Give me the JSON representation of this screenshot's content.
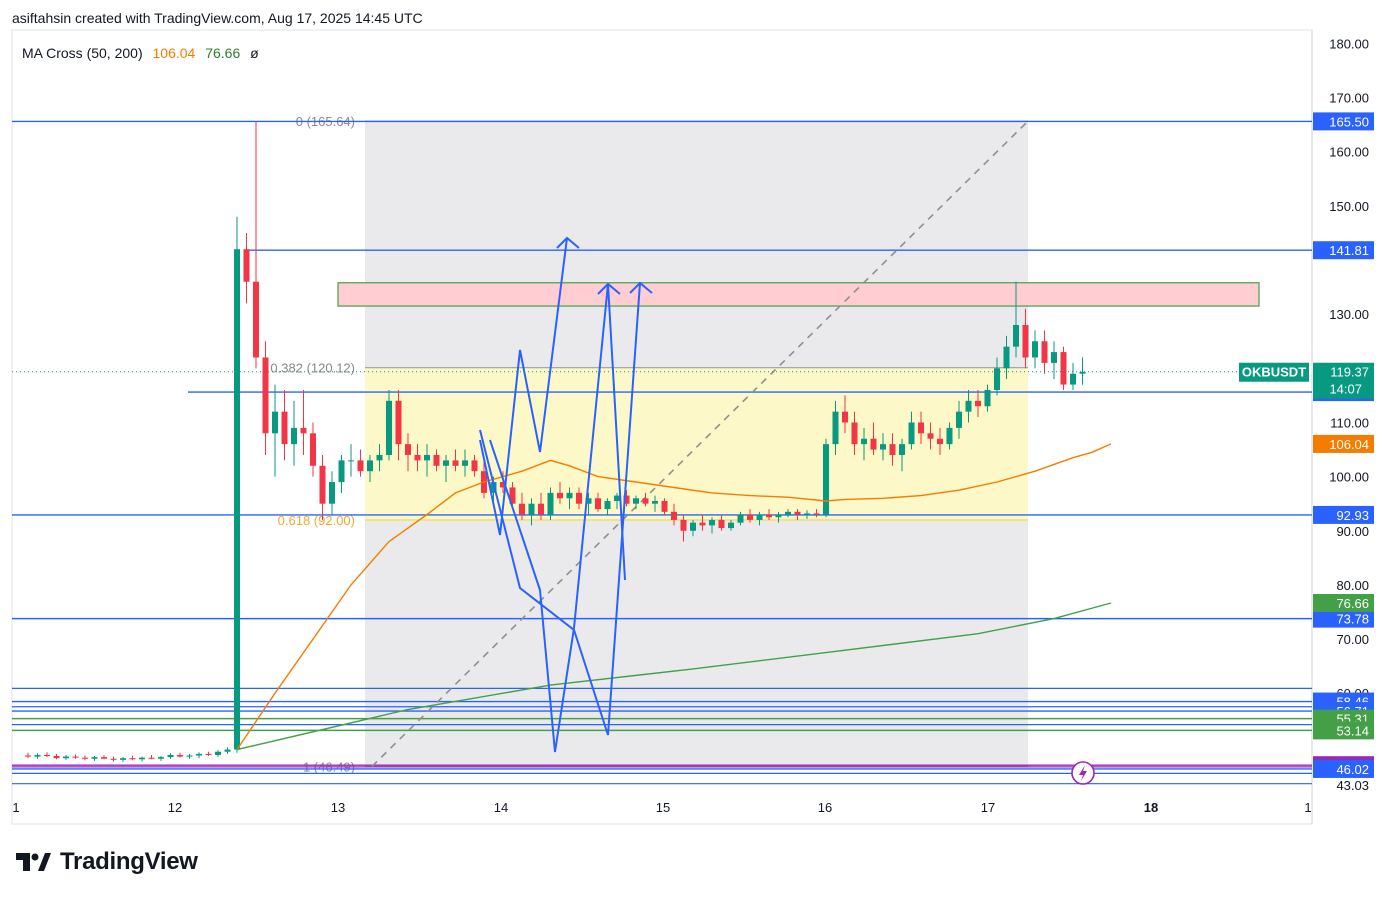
{
  "header": {
    "caption": "asiftahsin created with TradingView.com, Aug 17, 2025 14:45 UTC"
  },
  "indicator": {
    "name": "MA Cross (50, 200)",
    "ma_fast_value": "106.04",
    "ma_slow_value": "76.66",
    "extra_symbol": "ø"
  },
  "branding": {
    "logo_text": "TradingView"
  },
  "colors": {
    "up": "#089981",
    "down": "#f23645",
    "hline": "#2962ff",
    "zigzag": "#2962ff",
    "ma_fast": "#f57c00",
    "ma_slow": "#43a047",
    "fib_zone": "#fff9c4",
    "supply_zone": "#ffcdd2",
    "purple_line": "#9c27b0",
    "symbol_tag": "#089981"
  },
  "chart_data": {
    "type": "candlestick",
    "symbol": "OKBUSDT",
    "last_price": 119.37,
    "last_price_label": "119.37",
    "countdown_label": "14:07",
    "ylim": [
      42.5,
      181
    ],
    "x_axis_ticks": [
      "1",
      "12",
      "13",
      "14",
      "15",
      "16",
      "17",
      "18",
      "1"
    ],
    "x_axis_bold_tick": "18",
    "y_axis_ticks": [
      "180.00",
      "170.00",
      "160.00",
      "150.00",
      "130.00",
      "110.00",
      "100.00",
      "90.00",
      "80.00",
      "70.00",
      "60.00",
      "43.03"
    ],
    "price_level_lines": [
      {
        "label": "165.50",
        "value": 165.6,
        "color": "#2962ff"
      },
      {
        "label": "141.81",
        "value": 141.81,
        "color": "#2962ff"
      },
      {
        "label": "115.61",
        "value": 115.61,
        "color": "#2962ff"
      },
      {
        "label": "92.93",
        "value": 92.93,
        "color": "#2962ff"
      },
      {
        "label": "73.78",
        "value": 73.78,
        "color": "#2962ff"
      },
      {
        "label": "58.46",
        "value": 58.46,
        "color": "#2962ff"
      },
      {
        "label": "56.71",
        "value": 56.71,
        "color": "#2962ff"
      },
      {
        "label": "55.31",
        "value": 55.31,
        "color": "#43a047"
      },
      {
        "label": "53.14",
        "value": 53.14,
        "color": "#43a047"
      },
      {
        "label": "46.71",
        "value": 46.71,
        "color": "#9c27b0"
      },
      {
        "label": "46.02",
        "value": 46.02,
        "color": "#2962ff"
      }
    ],
    "extra_hlines": [
      60.9,
      57.5,
      54.2,
      46.4,
      45.2,
      43.3
    ],
    "ma_fast": {
      "label": "106.04",
      "value": 106.04
    },
    "ma_slow": {
      "label": "76.66",
      "value": 76.66
    },
    "fib_levels": [
      {
        "label": "0 (165.64)",
        "value": 165.64
      },
      {
        "label": "0.382 (120.12)",
        "value": 120.12
      },
      {
        "label": "0.618 (92.00)",
        "value": 92.0
      },
      {
        "label": "1 (46.49)",
        "value": 46.49
      }
    ],
    "supply_zone": [
      131.5,
      135.8
    ],
    "candles": [
      [
        48.5,
        49.0,
        48.0,
        48.3
      ],
      [
        48.3,
        48.9,
        47.9,
        48.6
      ],
      [
        48.6,
        49.1,
        48.2,
        48.4
      ],
      [
        48.4,
        48.8,
        47.8,
        48.0
      ],
      [
        48.0,
        48.6,
        47.7,
        48.3
      ],
      [
        48.3,
        48.7,
        47.9,
        48.1
      ],
      [
        48.1,
        48.5,
        47.6,
        47.9
      ],
      [
        47.9,
        48.4,
        47.5,
        48.2
      ],
      [
        48.2,
        48.6,
        47.8,
        47.9
      ],
      [
        47.9,
        48.3,
        47.4,
        47.7
      ],
      [
        47.7,
        48.2,
        47.3,
        48.0
      ],
      [
        48.0,
        48.5,
        47.6,
        47.8
      ],
      [
        47.8,
        48.3,
        47.4,
        48.1
      ],
      [
        48.1,
        48.6,
        47.8,
        47.9
      ],
      [
        47.9,
        48.4,
        47.5,
        48.2
      ],
      [
        48.2,
        48.9,
        47.9,
        48.6
      ],
      [
        48.6,
        49.0,
        48.1,
        48.3
      ],
      [
        48.3,
        48.8,
        47.9,
        48.5
      ],
      [
        48.5,
        49.1,
        48.0,
        48.8
      ],
      [
        48.8,
        49.2,
        48.4,
        48.6
      ],
      [
        48.6,
        49.5,
        48.3,
        49.2
      ],
      [
        49.2,
        50.0,
        48.8,
        49.6
      ],
      [
        49.6,
        148.0,
        49.0,
        142.0
      ],
      [
        142.0,
        145.0,
        132.0,
        136.0
      ],
      [
        136.0,
        165.64,
        120.0,
        122.0
      ],
      [
        122.0,
        125.0,
        104.0,
        108.0
      ],
      [
        108.0,
        117.0,
        100.0,
        112.0
      ],
      [
        112.0,
        116.0,
        103.0,
        106.0
      ],
      [
        106.0,
        114.0,
        102.0,
        109.0
      ],
      [
        109.0,
        116.0,
        104.0,
        108.0
      ],
      [
        108.0,
        110.0,
        100.0,
        102.0
      ],
      [
        102.0,
        104.0,
        92.0,
        95.0
      ],
      [
        95.0,
        101.0,
        93.0,
        99.0
      ],
      [
        99.0,
        104.0,
        97.0,
        103.0
      ],
      [
        103.0,
        106.0,
        100.0,
        103.0
      ],
      [
        103.0,
        105.0,
        100.0,
        101.0
      ],
      [
        101.0,
        104.0,
        99.0,
        103.0
      ],
      [
        103.0,
        106.0,
        101.0,
        104.0
      ],
      [
        104.0,
        116.0,
        103.0,
        114.0
      ],
      [
        114.0,
        116.0,
        103.0,
        106.0
      ],
      [
        106.0,
        108.0,
        101.0,
        104.0
      ],
      [
        104.0,
        106.0,
        101.0,
        103.0
      ],
      [
        103.0,
        106.0,
        100.0,
        104.0
      ],
      [
        104.0,
        105.0,
        101.0,
        102.0
      ],
      [
        102.0,
        104.0,
        99.0,
        103.0
      ],
      [
        103.0,
        105.0,
        101.0,
        102.0
      ],
      [
        102.0,
        105.0,
        100.0,
        103.0
      ],
      [
        103.0,
        104.0,
        100.0,
        101.0
      ],
      [
        101.0,
        103.0,
        96.0,
        97.0
      ],
      [
        97.0,
        100.0,
        95.0,
        99.0
      ],
      [
        99.0,
        101.0,
        97.0,
        98.0
      ],
      [
        98.0,
        99.0,
        94.0,
        95.0
      ],
      [
        95.0,
        97.0,
        92.0,
        93.0
      ],
      [
        93.0,
        96.0,
        91.0,
        95.0
      ],
      [
        95.0,
        97.0,
        92.0,
        93.0
      ],
      [
        93.0,
        98.0,
        92.0,
        97.0
      ],
      [
        97.0,
        99.0,
        95.0,
        96.0
      ],
      [
        96.0,
        98.0,
        94.0,
        97.0
      ],
      [
        97.0,
        98.0,
        94.0,
        95.0
      ],
      [
        95.0,
        97.0,
        93.0,
        96.0
      ],
      [
        96.0,
        97.0,
        93.5,
        94.0
      ],
      [
        94.0,
        96.0,
        93.0,
        95.5
      ],
      [
        95.5,
        97.0,
        94.0,
        96.5
      ],
      [
        96.5,
        97.5,
        94.5,
        95.0
      ],
      [
        95.0,
        96.5,
        94.0,
        96.0
      ],
      [
        96.0,
        97.0,
        94.5,
        95.0
      ],
      [
        95.0,
        96.5,
        93.5,
        95.5
      ],
      [
        95.5,
        96.0,
        93.0,
        93.5
      ],
      [
        93.5,
        95.0,
        91.0,
        92.0
      ],
      [
        92.0,
        93.0,
        88.0,
        90.0
      ],
      [
        90.0,
        92.0,
        89.0,
        91.5
      ],
      [
        91.5,
        93.0,
        90.0,
        91.0
      ],
      [
        91.0,
        92.5,
        89.5,
        92.0
      ],
      [
        92.0,
        93.0,
        90.0,
        90.5
      ],
      [
        90.5,
        92.0,
        90.0,
        91.5
      ],
      [
        91.5,
        93.5,
        91.0,
        93.0
      ],
      [
        93.0,
        94.0,
        91.5,
        92.0
      ],
      [
        92.0,
        93.5,
        91.0,
        93.0
      ],
      [
        93.0,
        94.0,
        92.0,
        92.5
      ],
      [
        92.5,
        93.5,
        91.5,
        93.0
      ],
      [
        93.0,
        94.0,
        92.5,
        93.5
      ],
      [
        93.5,
        94.0,
        92.0,
        93.0
      ],
      [
        93.0,
        93.8,
        92.2,
        93.2
      ],
      [
        93.2,
        94.0,
        92.5,
        93.0
      ],
      [
        93.0,
        107.0,
        92.5,
        106.0
      ],
      [
        106.0,
        114.0,
        104.0,
        112.0
      ],
      [
        112.0,
        115.0,
        108.0,
        110.0
      ],
      [
        110.0,
        112.0,
        104.0,
        106.0
      ],
      [
        106.0,
        109.0,
        103.0,
        107.0
      ],
      [
        107.0,
        110.0,
        104.0,
        105.0
      ],
      [
        105.0,
        108.0,
        103.0,
        106.0
      ],
      [
        106.0,
        108.0,
        102.0,
        104.0
      ],
      [
        104.0,
        107.0,
        101.0,
        106.0
      ],
      [
        106.0,
        112.0,
        105.0,
        110.0
      ],
      [
        110.0,
        112.0,
        106.0,
        108.0
      ],
      [
        108.0,
        110.0,
        105.0,
        107.0
      ],
      [
        107.0,
        109.0,
        104.0,
        106.0
      ],
      [
        106.0,
        110.0,
        105.0,
        109.0
      ],
      [
        109.0,
        114.0,
        107.0,
        112.0
      ],
      [
        112.0,
        116.0,
        110.0,
        114.0
      ],
      [
        114.0,
        116.0,
        111.0,
        113.0
      ],
      [
        113.0,
        117.0,
        112.0,
        116.0
      ],
      [
        116.0,
        122.0,
        115.0,
        120.0
      ],
      [
        120.0,
        126.0,
        118.0,
        124.0
      ],
      [
        124.0,
        136.0,
        122.0,
        128.0
      ],
      [
        128.0,
        131.0,
        120.0,
        122.0
      ],
      [
        122.0,
        127.0,
        120.0,
        125.0
      ],
      [
        125.0,
        127.0,
        119.0,
        121.0
      ],
      [
        121.0,
        125.0,
        118.0,
        123.0
      ],
      [
        123.0,
        124.0,
        116.0,
        117.0
      ],
      [
        117.0,
        121.0,
        116.0,
        119.0
      ],
      [
        119.0,
        122.0,
        117.0,
        119.37
      ]
    ],
    "ma_fast_series": [
      [
        22,
        49.6
      ],
      [
        26,
        60.0
      ],
      [
        30,
        70.0
      ],
      [
        34,
        80.0
      ],
      [
        38,
        88.0
      ],
      [
        42,
        93.0
      ],
      [
        45,
        97.0
      ],
      [
        48,
        99.0
      ],
      [
        52,
        101.0
      ],
      [
        55,
        103.0
      ],
      [
        57,
        102.0
      ],
      [
        60,
        100.0
      ],
      [
        64,
        99.0
      ],
      [
        68,
        98.0
      ],
      [
        72,
        97.0
      ],
      [
        76,
        96.5
      ],
      [
        80,
        96.2
      ],
      [
        84,
        95.5
      ],
      [
        86,
        95.8
      ],
      [
        90,
        96.0
      ],
      [
        94,
        96.5
      ],
      [
        98,
        97.5
      ],
      [
        102,
        99.0
      ],
      [
        106,
        101.0
      ],
      [
        110,
        103.5
      ],
      [
        112,
        104.5
      ],
      [
        114,
        106.04
      ]
    ],
    "ma_slow_series": [
      [
        22,
        49.6
      ],
      [
        40,
        57.0
      ],
      [
        55,
        61.5
      ],
      [
        70,
        64.5
      ],
      [
        84,
        67.5
      ],
      [
        100,
        71.0
      ],
      [
        108,
        73.78
      ],
      [
        114,
        76.66
      ]
    ]
  }
}
